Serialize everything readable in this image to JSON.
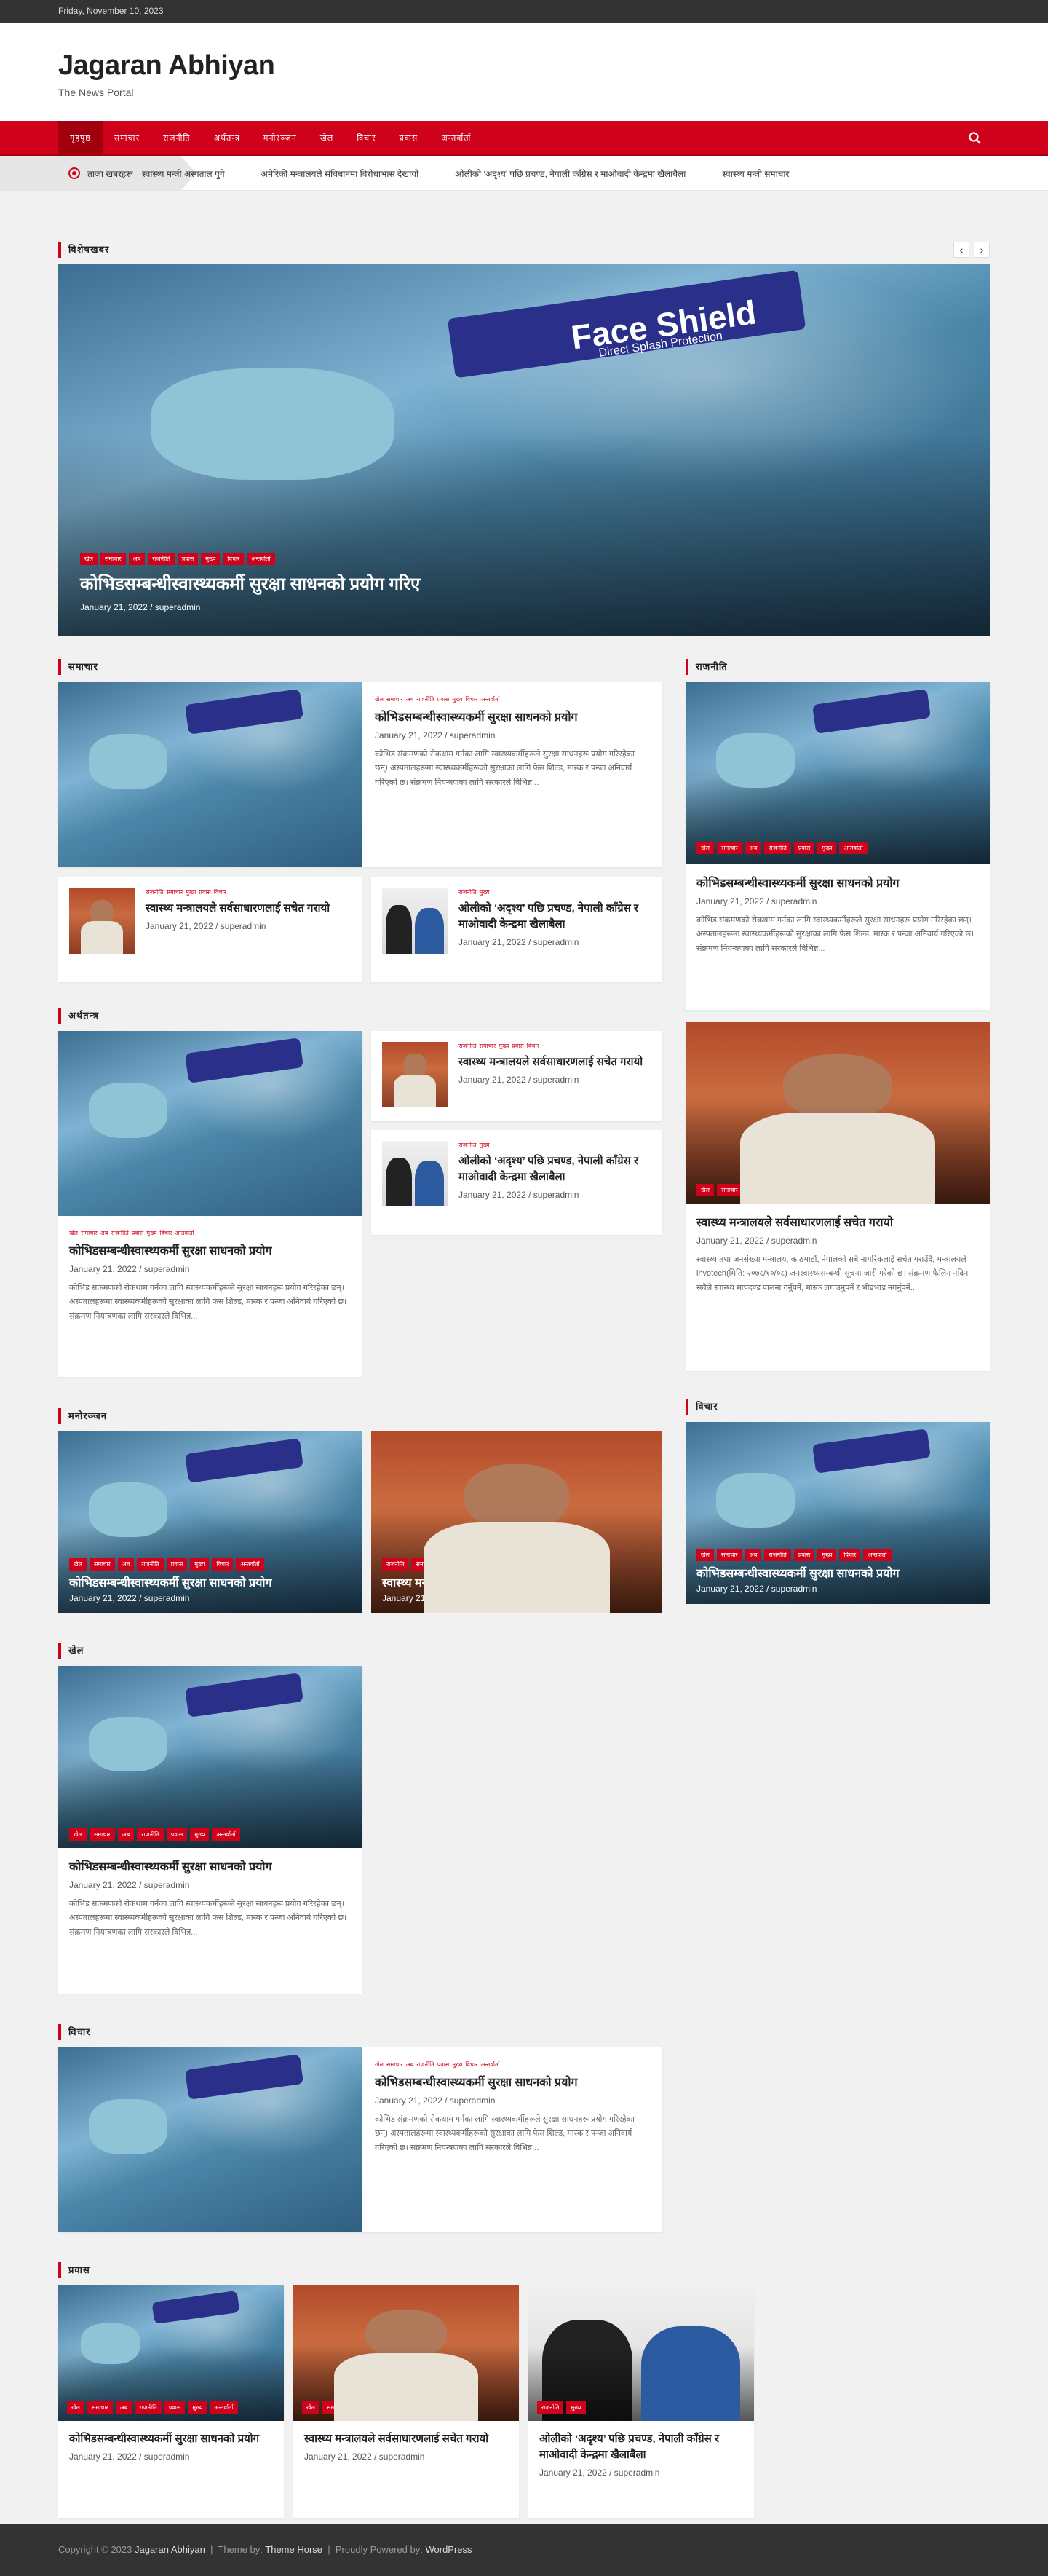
{
  "topbar": {
    "date": "Friday, November 10, 2023"
  },
  "site": {
    "title": "Jagaran Abhiyan",
    "tagline": "The News Portal"
  },
  "nav": {
    "items": [
      "गृहपृष्ठ",
      "समाचार",
      "राजनीति",
      "अर्थतन्त्र",
      "मनोरञ्जन",
      "खेल",
      "विचार",
      "प्रवास",
      "अन्तर्वार्ता"
    ]
  },
  "ticker": {
    "label": "ताजा खबरहरू",
    "items": [
      "स्वास्थ्य मन्त्री अस्पताल पुगे",
      "अमेरिकी मन्त्रालयले संविधानमा विरोधाभास देखायो",
      "ओलीको ‘अदृश्य’ पछि प्रचण्ड, नेपाली काँग्रेस र माओवादी केन्द्रमा खैलाबैला",
      "स्वास्थ्य मन्त्री समाचार"
    ]
  },
  "featured": {
    "heading": "विशेषखबर",
    "prev": "‹",
    "next": "›",
    "shield_text": "Face Shield",
    "shield_sub": "Direct Splash Protection",
    "cats": [
      "खेल",
      "समाचार",
      "अब",
      "राजनीति",
      "प्रवास",
      "मुख्य",
      "विचार",
      "अन्तर्वार्ता"
    ],
    "title": "कोभिडसम्बन्धीस्वास्थ्यकर्मी सुरक्षा साधनको प्रयोग गरिए",
    "date": "January 21, 2022",
    "author": "superadmin"
  },
  "sec1": {
    "heading": "समाचार",
    "big": {
      "cats": [
        "खेल",
        "समाचार",
        "अब",
        "राजनीति",
        "प्रवास",
        "मुख्य",
        "विचार",
        "अन्तर्वार्ता"
      ],
      "title": "कोभिडसम्बन्धीस्वास्थ्यकर्मी सुरक्षा साधनको प्रयोग",
      "date": "January 21, 2022",
      "author": "superadmin",
      "excerpt": "कोभिड संक्रमणको रोकथाम गर्नका लागि स्वास्थ्यकर्मीहरूले सुरक्षा साधनहरू प्रयोग गरिरहेका छन्। अस्पतालहरूमा स्वास्थ्यकर्मीहरूको सुरक्षाका लागि फेस शिल्ड, मास्क र पन्जा अनिवार्य गरिएको छ। संक्रमण नियन्त्रणका लागि सरकारले विभिन्न..."
    },
    "small1": {
      "cats": [
        "राजनीति",
        "समाचार",
        "मुख्य",
        "प्रवास",
        "विचार"
      ],
      "title": "स्वास्थ्य मन्त्रालयले सर्वसाधारणलाई सचेत गरायो",
      "date": "January 21, 2022",
      "author": "superadmin"
    },
    "small2": {
      "cats": [
        "राजनीति",
        "मुख्य"
      ],
      "title": "ओलीको ‘अदृश्य’ पछि प्रचण्ड, नेपाली काँग्रेस र माओवादी केन्द्रमा खैलाबैला",
      "date": "January 21, 2022",
      "author": "superadmin"
    }
  },
  "side1": {
    "heading": "राजनीति",
    "cats": [
      "खेल",
      "समाचार",
      "अब",
      "राजनीति",
      "प्रवास",
      "मुख्य",
      "अन्तर्वार्ता"
    ],
    "title": "कोभिडसम्बन्धीस्वास्थ्यकर्मी सुरक्षा साधनको प्रयोग",
    "date": "January 21, 2022",
    "author": "superadmin",
    "excerpt": "कोभिड संक्रमणको रोकथाम गर्नका लागि स्वास्थ्यकर्मीहरूले सुरक्षा साधनहरू प्रयोग गरिरहेका छन्। अस्पतालहरूमा स्वास्थ्यकर्मीहरूको सुरक्षाका लागि फेस शिल्ड, मास्क र पन्जा अनिवार्य गरिएको छ। संक्रमण नियन्त्रणका लागि सरकारले विभिन्न..."
  },
  "sec2": {
    "heading": "अर्थतन्त्र",
    "big": {
      "cats": [
        "खेल",
        "समाचार",
        "अब",
        "राजनीति",
        "प्रवास",
        "मुख्य",
        "विचार",
        "अन्तर्वार्ता"
      ],
      "title": "कोभिडसम्बन्धीस्वास्थ्यकर्मी सुरक्षा साधनको प्रयोग",
      "date": "January 21, 2022",
      "author": "superadmin",
      "excerpt": "कोभिड संक्रमणको रोकथाम गर्नका लागि स्वास्थ्यकर्मीहरूले सुरक्षा साधनहरू प्रयोग गरिरहेका छन्। अस्पतालहरूमा स्वास्थ्यकर्मीहरूको सुरक्षाका लागि फेस शिल्ड, मास्क र पन्जा अनिवार्य गरिएको छ। संक्रमण नियन्त्रणका लागि सरकारले विभिन्न..."
    },
    "small1": {
      "cats": [
        "राजनीति",
        "समाचार",
        "मुख्य",
        "प्रवास",
        "विचार"
      ],
      "title": "स्वास्थ्य मन्त्रालयले सर्वसाधारणलाई सचेत गरायो",
      "date": "January 21, 2022",
      "author": "superadmin"
    },
    "small2": {
      "cats": [
        "राजनीति",
        "मुख्य"
      ],
      "title": "ओलीको ‘अदृश्य’ पछि प्रचण्ड, नेपाली काँग्रेस र माओवादी केन्द्रमा खैलाबैला",
      "date": "January 21, 2022",
      "author": "superadmin"
    }
  },
  "side2": {
    "cats": [
      "खेल",
      "समाचार",
      "मुख्य",
      "प्रवास",
      "अन्तर्वार्ता"
    ],
    "title": "स्वास्थ्य मन्त्रालयले सर्वसाधारणलाई सचेत गरायो",
    "date": "January 21, 2022",
    "author": "superadmin",
    "excerpt": "स्वास्थ्य तथा जनसंख्या मन्त्रालय, काठमाडौं, नेपालको सबै नागरिकलाई सचेत गराउँदै, मन्त्रालयले invotech(मिति: २०७८/१०/०८) जनस्वास्थ्यसम्बन्धी सूचना जारी गरेको छ। संक्रमण फैलिन नदिन सबैले स्वास्थ्य मापदण्ड पालना गर्नुपर्ने, मास्क लगाउनुपर्ने र भीडभाड नगर्नुपर्ने..."
  },
  "sec3": {
    "heading": "मनोरञ्जन",
    "card1": {
      "cats": [
        "खेल",
        "समाचार",
        "अब",
        "राजनीति",
        "प्रवास",
        "मुख्य",
        "विचार",
        "अन्तर्वार्ता"
      ],
      "title": "कोभिडसम्बन्धीस्वास्थ्यकर्मी सुरक्षा साधनको प्रयोग",
      "date": "January 21, 2022",
      "author": "superadmin"
    },
    "card2": {
      "cats": [
        "राजनीति",
        "समाचार",
        "मुख्य",
        "प्रवास",
        "अन्तर्वार्ता"
      ],
      "title": "स्वास्थ्य मन्त्रालयले सर्वसाधारणलाई",
      "date": "January 21, 2022",
      "author": "superadmin"
    }
  },
  "side3": {
    "heading": "विचार",
    "cats": [
      "खेल",
      "समाचार",
      "अब",
      "राजनीति",
      "प्रवास",
      "मुख्य",
      "विचार",
      "अन्तर्वार्ता"
    ],
    "title": "कोभिडसम्बन्धीस्वास्थ्यकर्मी सुरक्षा साधनको प्रयोग",
    "date": "January 21, 2022",
    "author": "superadmin"
  },
  "sec4": {
    "heading": "खेल",
    "cats": [
      "खेल",
      "समाचार",
      "अब",
      "राजनीति",
      "प्रवास",
      "मुख्य",
      "अन्तर्वार्ता"
    ],
    "title": "कोभिडसम्बन्धीस्वास्थ्यकर्मी सुरक्षा साधनको प्रयोग",
    "date": "January 21, 2022",
    "author": "superadmin",
    "excerpt": "कोभिड संक्रमणको रोकथाम गर्नका लागि स्वास्थ्यकर्मीहरूले सुरक्षा साधनहरू प्रयोग गरिरहेका छन्। अस्पतालहरूमा स्वास्थ्यकर्मीहरूको सुरक्षाका लागि फेस शिल्ड, मास्क र पन्जा अनिवार्य गरिएको छ। संक्रमण नियन्त्रणका लागि सरकारले विभिन्न..."
  },
  "sec5": {
    "heading": "विचार",
    "cats": [
      "खेल",
      "समाचार",
      "अब",
      "राजनीति",
      "प्रवास",
      "मुख्य",
      "विचार",
      "अन्तर्वार्ता"
    ],
    "title": "कोभिडसम्बन्धीस्वास्थ्यकर्मी सुरक्षा साधनको प्रयोग",
    "date": "January 21, 2022",
    "author": "superadmin",
    "excerpt": "कोभिड संक्रमणको रोकथाम गर्नका लागि स्वास्थ्यकर्मीहरूले सुरक्षा साधनहरू प्रयोग गरिरहेका छन्। अस्पतालहरूमा स्वास्थ्यकर्मीहरूको सुरक्षाका लागि फेस शिल्ड, मास्क र पन्जा अनिवार्य गरिएको छ। संक्रमण नियन्त्रणका लागि सरकारले विभिन्न..."
  },
  "sec6": {
    "heading": "प्रवास",
    "cards": [
      {
        "cats": [
          "खेल",
          "समाचार",
          "अब",
          "राजनीति",
          "प्रवास",
          "मुख्य",
          "अन्तर्वार्ता"
        ],
        "title": "कोभिडसम्बन्धीस्वास्थ्यकर्मी सुरक्षा साधनको प्रयोग",
        "date": "January 21, 2022",
        "author": "superadmin"
      },
      {
        "cats": [
          "खेल",
          "समाचार",
          "मुख्य",
          "प्रवास",
          "अन्तर्वार्ता"
        ],
        "title": "स्वास्थ्य मन्त्रालयले सर्वसाधारणलाई सचेत गरायो",
        "date": "January 21, 2022",
        "author": "superadmin"
      },
      {
        "cats": [
          "राजनीति",
          "मुख्य"
        ],
        "title": "ओलीको ‘अदृश्य’ पछि प्रचण्ड, नेपाली काँग्रेस र माओवादी केन्द्रमा खैलाबैला",
        "date": "January 21, 2022",
        "author": "superadmin"
      }
    ]
  },
  "footer": {
    "copyright": "Copyright © 2023",
    "site_link": "Jagaran Abhiyan",
    "sep": "|",
    "theme_label": "Theme by:",
    "theme_link": "Theme Horse",
    "powered_label": "Proudly Powered by:",
    "powered_link": "WordPress"
  },
  "colors": {
    "accent": "#d0021b",
    "accent_dark": "#a3000f",
    "topbar": "#333333",
    "footer": "#333333"
  }
}
